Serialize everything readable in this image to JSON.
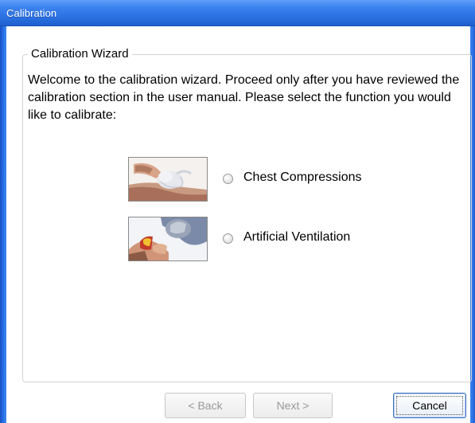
{
  "window": {
    "title": "Calibration"
  },
  "group": {
    "legend": "Calibration Wizard",
    "intro": "Welcome to the calibration wizard.  Proceed only after you have reviewed the calibration section in the user manual.  Please select the function you would like to calibrate:"
  },
  "options": [
    {
      "label": "Chest Compressions",
      "icon": "chest-compressions-image",
      "selected": false
    },
    {
      "label": "Artificial Ventilation",
      "icon": "artificial-ventilation-image",
      "selected": false
    }
  ],
  "buttons": {
    "back": "< Back",
    "next": "Next >",
    "cancel": "Cancel"
  },
  "colors": {
    "titlebar": "#2a6fe0",
    "frame": "#2a74e8",
    "background": "#ffffff"
  }
}
